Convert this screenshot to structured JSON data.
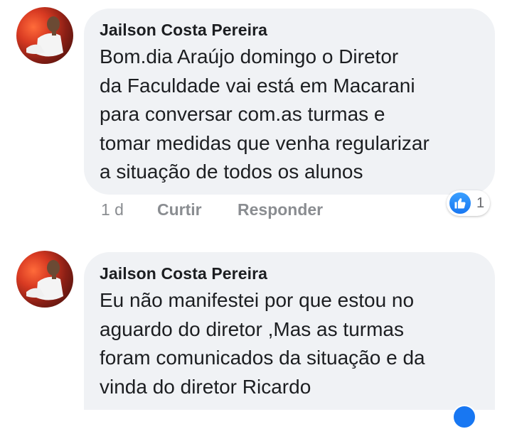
{
  "comments": [
    {
      "author": "Jailson Costa Pereira",
      "text": "Bom.dia Araújo  domingo o Diretor\nda Faculdade vai está em Macarani\npara conversar com.as turmas e\ntomar medidas que venha regularizar\na situação de todos os alunos",
      "time": "1 d",
      "like_label": "Curtir",
      "reply_label": "Responder",
      "reaction_count": "1"
    },
    {
      "author": "Jailson Costa Pereira",
      "text": "Eu não manifestei por que estou no\naguardo do diretor ,Mas as turmas\nforam comunicados da situação e da\nvinda do diretor Ricardo"
    }
  ],
  "colors": {
    "bubble": "#f0f2f5",
    "like_blue": "#1877f2",
    "meta_gray": "#8a8d91"
  }
}
